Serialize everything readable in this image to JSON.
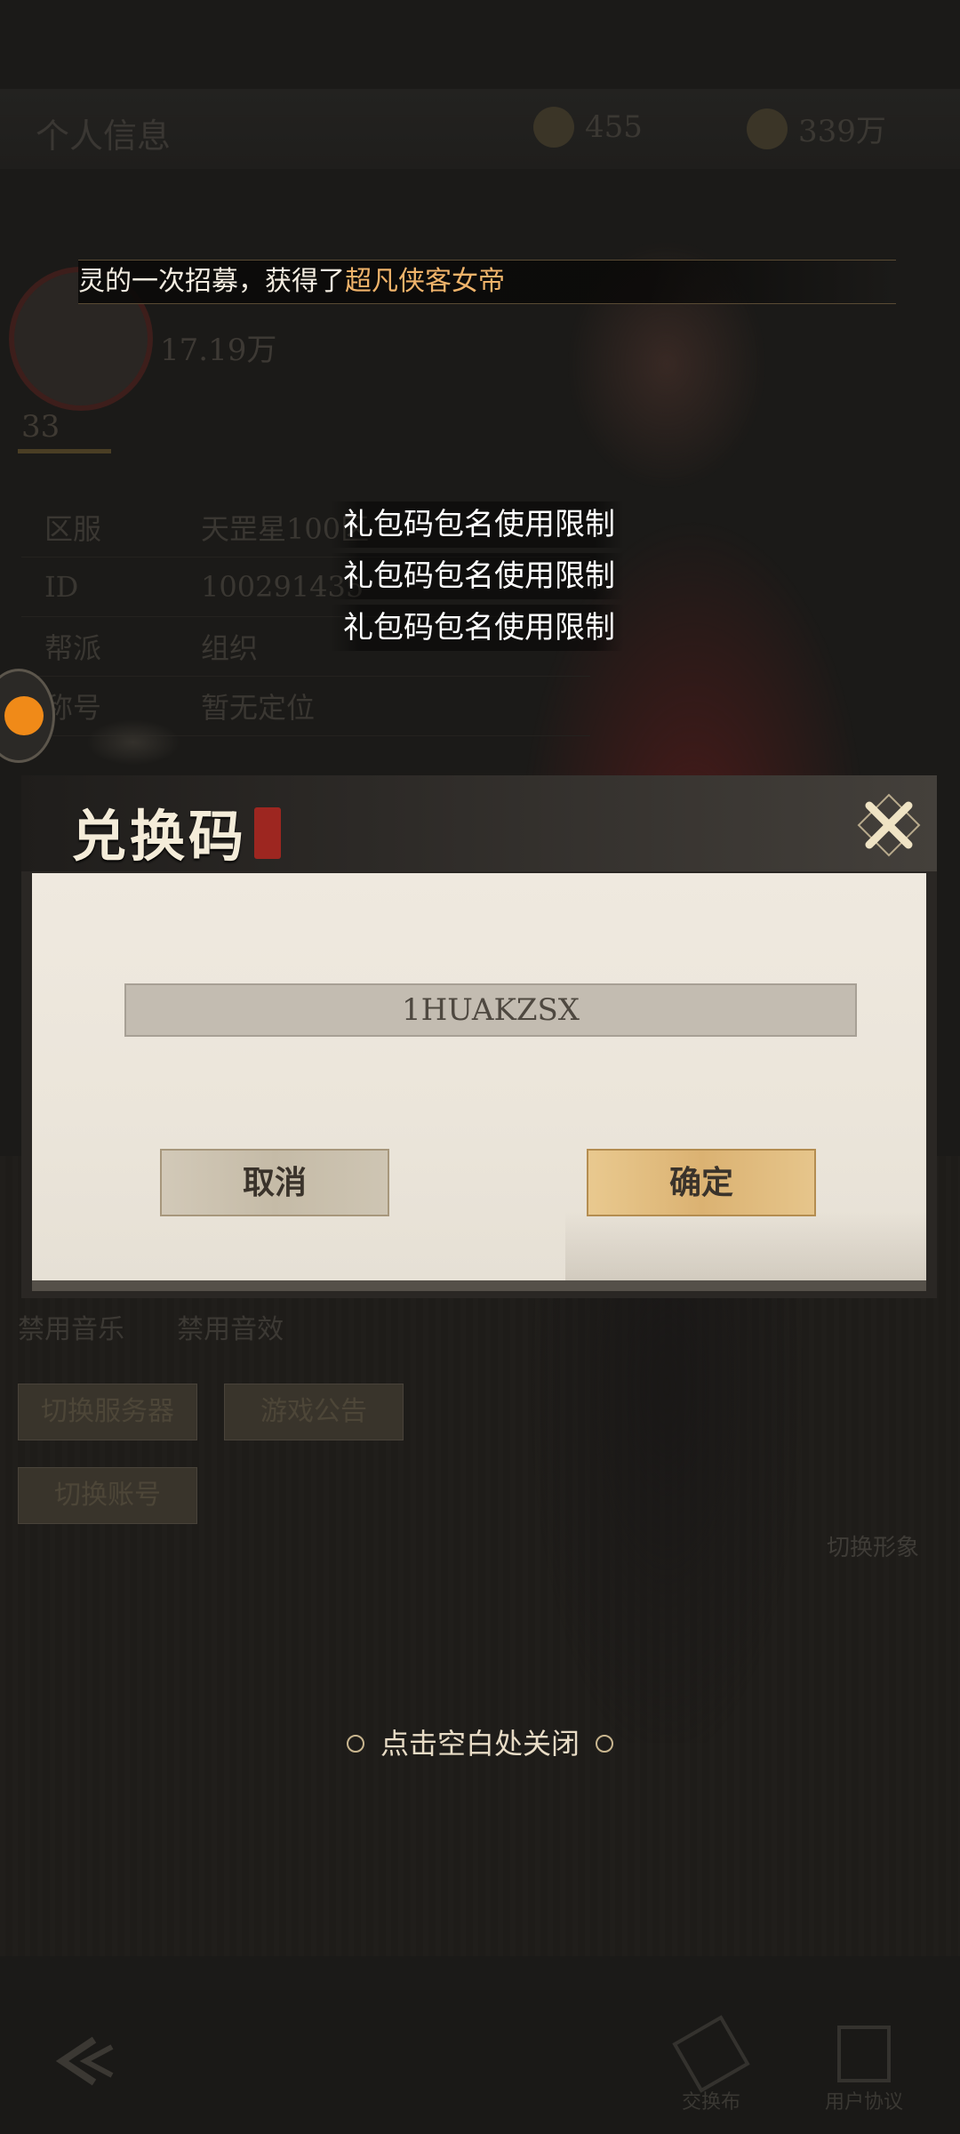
{
  "background": {
    "header_title": "个人信息",
    "currency_1": "455",
    "currency_2": "339万",
    "level": "33",
    "power": "17.19万",
    "info_rows": [
      {
        "key": "区服",
        "value": "天罡星100区"
      },
      {
        "key": "ID",
        "value": "100291435"
      },
      {
        "key": "帮派",
        "value": "组织"
      },
      {
        "key": "称号",
        "value": "暂无定位"
      }
    ],
    "settings": {
      "music_label": "禁用音乐",
      "sfx_label": "禁用音效",
      "buttons": [
        "切换服务器",
        "游戏公告",
        "切换账号"
      ],
      "switch_appearance": "切换形象"
    },
    "bottom_bar": [
      "交换布",
      "用户协议"
    ]
  },
  "broadcast": {
    "prefix": "灵的一次招募，获得了",
    "highlight": "超凡侠客女帝"
  },
  "limit_messages": [
    "礼包码包名使用限制",
    "礼包码包名使用限制",
    "礼包码包名使用限制"
  ],
  "dialog": {
    "title": "兑换码",
    "code_value": "1HUAKZSX",
    "cancel_label": "取消",
    "confirm_label": "确定"
  },
  "close_hint": "点击空白处关闭",
  "colors": {
    "highlight": "#f0b36a",
    "confirm_button": "#dbb272",
    "cancel_button": "#c5bba7",
    "dialog_body": "#ebe5da"
  }
}
